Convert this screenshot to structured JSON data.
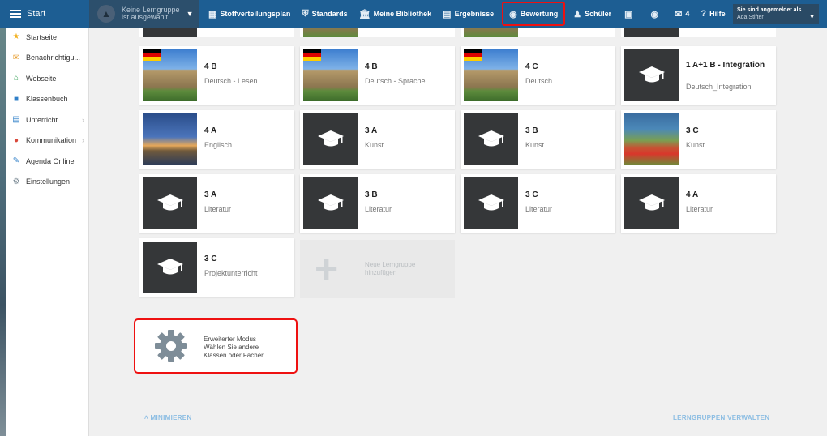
{
  "topbar": {
    "start_label": "Start",
    "group_select": {
      "line1": "Keine Lerngruppe",
      "line2": "ist ausgewählt"
    },
    "nav": [
      {
        "label": "Stoffverteilungsplan",
        "icon": "calendar-icon"
      },
      {
        "label": "Standards",
        "icon": "shield-icon"
      },
      {
        "label": "Meine Bibliothek",
        "icon": "library-icon"
      },
      {
        "label": "Ergebnisse",
        "icon": "bar-chart-icon"
      },
      {
        "label": "Bewertung",
        "icon": "badge-icon"
      },
      {
        "label": "Schüler",
        "icon": "students-icon"
      },
      {
        "label": "",
        "icon": "screen-icon"
      },
      {
        "label": "",
        "icon": "chat-icon"
      },
      {
        "label": "4",
        "icon": "mail-icon"
      },
      {
        "label": "Hilfe",
        "icon": "help-icon"
      }
    ],
    "login": {
      "heading": "Sie sind angemeldet als",
      "user": "Ada Stifter"
    }
  },
  "sidebar": {
    "items": [
      {
        "label": "Startseite",
        "icon": "star-icon",
        "color": "#f2b01e",
        "chevron": false
      },
      {
        "label": "Benachrichtigu...",
        "icon": "mail-icon",
        "color": "#e9a33a",
        "chevron": false
      },
      {
        "label": "Webseite",
        "icon": "home-icon",
        "color": "#3aa35a",
        "chevron": false
      },
      {
        "label": "Klassenbuch",
        "icon": "book-icon",
        "color": "#2f7fc8",
        "chevron": false
      },
      {
        "label": "Unterricht",
        "icon": "books-icon",
        "color": "#2f7fc8",
        "chevron": true
      },
      {
        "label": "Kommunikation",
        "icon": "chat-icon",
        "color": "#d9483b",
        "chevron": true
      },
      {
        "label": "Agenda Online",
        "icon": "pen-icon",
        "color": "#2f7fc8",
        "chevron": false
      },
      {
        "label": "Einstellungen",
        "icon": "gear-icon",
        "color": "#7b8a95",
        "chevron": false
      }
    ]
  },
  "tiles": [
    {
      "title": "4 B",
      "subtitle": "Deutsch - Lesen",
      "thumb": "reichstag"
    },
    {
      "title": "4 B",
      "subtitle": "Deutsch - Sprache",
      "thumb": "reichstag"
    },
    {
      "title": "4 C",
      "subtitle": "Deutsch",
      "thumb": "reichstag"
    },
    {
      "title": "1 A+1 B - Integration",
      "subtitle": "Deutsch_Integration",
      "thumb": "dark"
    },
    {
      "title": "4 A",
      "subtitle": "Englisch",
      "thumb": "london"
    },
    {
      "title": "3 A",
      "subtitle": "Kunst",
      "thumb": "dark"
    },
    {
      "title": "3 B",
      "subtitle": "Kunst",
      "thumb": "dark"
    },
    {
      "title": "3 C",
      "subtitle": "Kunst",
      "thumb": "painting"
    },
    {
      "title": "3 A",
      "subtitle": "Literatur",
      "thumb": "dark"
    },
    {
      "title": "3 B",
      "subtitle": "Literatur",
      "thumb": "dark"
    },
    {
      "title": "3 C",
      "subtitle": "Literatur",
      "thumb": "dark"
    },
    {
      "title": "4 A",
      "subtitle": "Literatur",
      "thumb": "dark"
    },
    {
      "title": "3 C",
      "subtitle": "Projektunterricht",
      "thumb": "dark"
    }
  ],
  "new_group": {
    "line1": "Neue Lerngruppe",
    "line2": "hinzufügen"
  },
  "advanced": {
    "line1": "Erweiterter Modus",
    "line2": "Wählen Sie andere",
    "line3": "Klassen oder Fächer"
  },
  "footer": {
    "minimize": "MINIMIEREN",
    "manage": "LERNGRUPPEN VERWALTEN"
  }
}
